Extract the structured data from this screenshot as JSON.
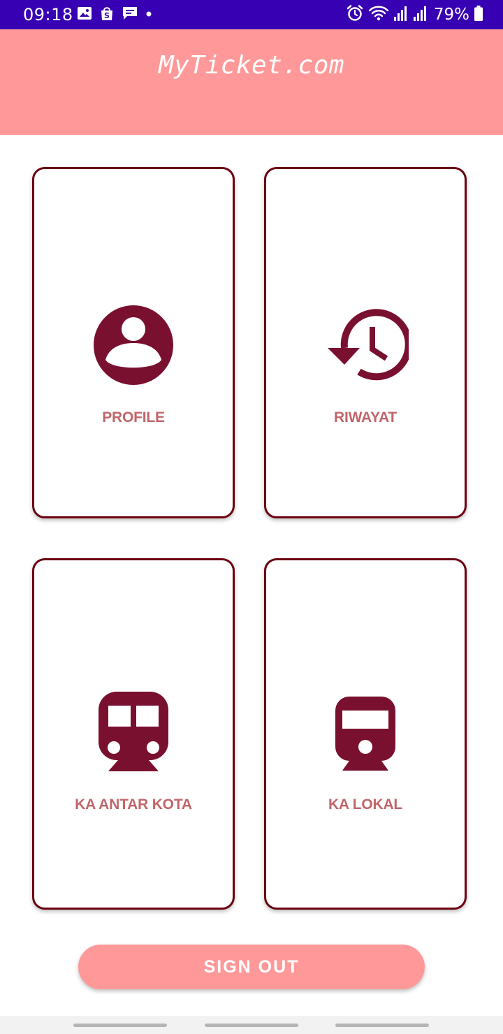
{
  "status_bar": {
    "time": "09:18",
    "battery_percent": "79%",
    "background_color": "#3700b3",
    "left_icons": [
      "gallery-icon",
      "shopee-icon",
      "message-icon",
      "dot-icon"
    ],
    "right_icons": [
      "alarm-icon",
      "wifi-icon",
      "signal-icon",
      "signal-icon",
      "battery-icon"
    ]
  },
  "header": {
    "title": "MyTicket.com",
    "background_color": "#ff9999"
  },
  "menu": {
    "items": [
      {
        "label": "PROFILE",
        "icon": "account-circle-icon"
      },
      {
        "label": "RIWAYAT",
        "icon": "history-icon"
      },
      {
        "label": "KA ANTAR KOTA",
        "icon": "train-icon"
      },
      {
        "label": "KA LOKAL",
        "icon": "local-train-icon"
      }
    ],
    "card_border_color": "#6b0010",
    "icon_color": "#7a1030",
    "label_color": "#c0666a"
  },
  "sign_out": {
    "label": "SIGN OUT",
    "background_color": "#ff9999"
  },
  "nav_bar": {
    "buttons": [
      "recent-apps-handle",
      "home-handle",
      "back-handle"
    ]
  }
}
